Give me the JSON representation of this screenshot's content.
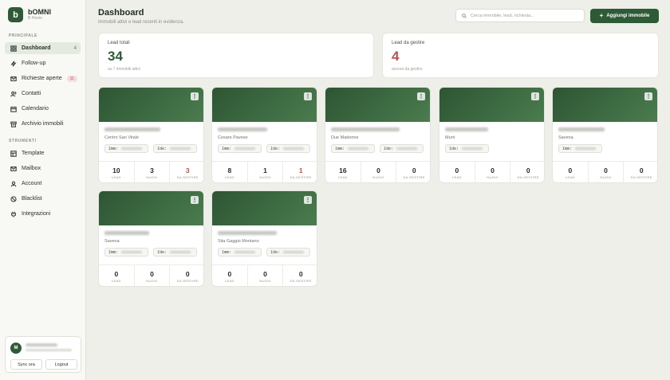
{
  "brand": {
    "name": "bOMNI",
    "sub": "B Home",
    "logo_letter": "b"
  },
  "sidebar": {
    "section_main": "PRINCIPALE",
    "section_tools": "STRUMENTI",
    "main_items": [
      {
        "label": "Dashboard",
        "icon": "grid-icon",
        "count": "4",
        "active": true
      },
      {
        "label": "Follow-up",
        "icon": "zap-icon"
      },
      {
        "label": "Richieste aperte",
        "icon": "mail-icon",
        "badge": "11"
      },
      {
        "label": "Contatti",
        "icon": "users-icon"
      },
      {
        "label": "Calendario",
        "icon": "calendar-icon"
      },
      {
        "label": "Archivio immobili",
        "icon": "archive-icon"
      }
    ],
    "tool_items": [
      {
        "label": "Template",
        "icon": "template-icon"
      },
      {
        "label": "Mailbox",
        "icon": "mail-icon"
      },
      {
        "label": "Account",
        "icon": "user-icon"
      },
      {
        "label": "Blacklist",
        "icon": "ban-icon"
      },
      {
        "label": "Integrazioni",
        "icon": "plug-icon"
      }
    ],
    "user": {
      "initial": "M",
      "sync_label": "Sync ora",
      "logout_label": "Logout"
    }
  },
  "header": {
    "title": "Dashboard",
    "subtitle": "Immobili attivi e lead recenti in evidenza.",
    "search_placeholder": "Cerca immobile, lead, richiesta...",
    "add_label": "Aggiungi immobile"
  },
  "stats": [
    {
      "label": "Lead totali",
      "value": "34",
      "note": "su 7 immobili attivi",
      "color": "#2f5a36"
    },
    {
      "label": "Lead da gestire",
      "value": "4",
      "note": "ancora da gestire",
      "color": "#c0504d"
    }
  ],
  "stat_labels": {
    "lead": "LEAD",
    "nuovi": "NUOVI",
    "gestire": "DA GESTIRE"
  },
  "properties": [
    {
      "location": "Centro San Vitale",
      "chips": [
        "Imm:",
        "Ide:"
      ],
      "lead": "10",
      "nuovi": "3",
      "gestire": "3",
      "gestire_red": true
    },
    {
      "location": "Cesare Pavese",
      "chips": [
        "Imm:",
        "Ide:"
      ],
      "lead": "8",
      "nuovi": "1",
      "gestire": "1",
      "gestire_red": true
    },
    {
      "location": "Due Madonne",
      "chips": [
        "Imm:",
        "Ide:"
      ],
      "lead": "16",
      "nuovi": "0",
      "gestire": "0",
      "gestire_red": false
    },
    {
      "location": "Murri",
      "chips": [
        "Ide:"
      ],
      "lead": "0",
      "nuovi": "0",
      "gestire": "0",
      "gestire_red": false
    },
    {
      "location": "Savena",
      "chips": [
        "Imm:"
      ],
      "lead": "0",
      "nuovi": "0",
      "gestire": "0",
      "gestire_red": false
    },
    {
      "location": "Savena",
      "chips": [
        "Imm:",
        "Ide:"
      ],
      "lead": "0",
      "nuovi": "0",
      "gestire": "0",
      "gestire_red": false
    },
    {
      "location": "Sita Gaggio Montano",
      "chips": [
        "Imm:",
        "Ide:"
      ],
      "lead": "0",
      "nuovi": "0",
      "gestire": "0",
      "gestire_red": false
    }
  ],
  "colors": {
    "accent": "#2f5a36",
    "danger": "#c0504d",
    "background": "#efefea"
  }
}
